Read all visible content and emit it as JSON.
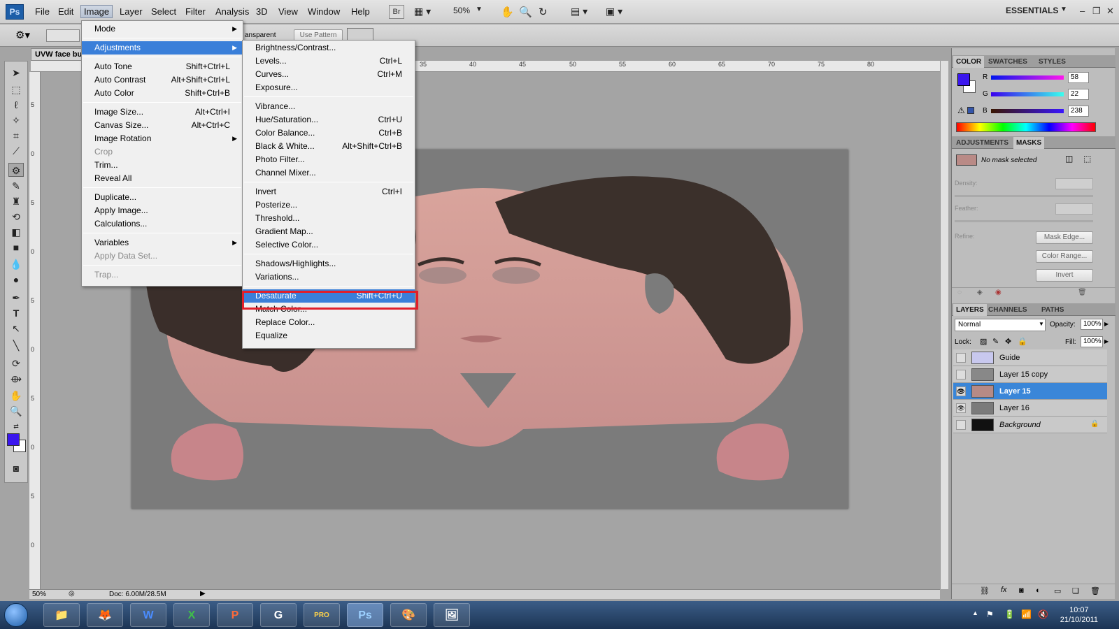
{
  "app": {
    "logo": "Ps",
    "workspace": "ESSENTIALS",
    "zoom": "50%"
  },
  "menubar": [
    "File",
    "Edit",
    "Image",
    "Layer",
    "Select",
    "Filter",
    "Analysis",
    "3D",
    "View",
    "Window",
    "Help"
  ],
  "toolbar": {
    "bridge": "Br"
  },
  "options": {
    "transparent_label": "ansparent",
    "use_pattern": "Use Pattern"
  },
  "document": {
    "tab_title": "UVW face bu",
    "zoom_status": "50%",
    "doc_info": "Doc: 6.00M/28.5M"
  },
  "ruler_top": [
    "35",
    "40",
    "45",
    "50",
    "55",
    "60",
    "65",
    "70",
    "75",
    "80"
  ],
  "ruler_left": [
    "5",
    "0",
    "5",
    "0",
    "5",
    "0",
    "5",
    "0",
    "5",
    "0",
    "5"
  ],
  "image_menu": {
    "items": [
      {
        "label": "Mode",
        "shortcut": "",
        "submenu": true,
        "disabled": false
      },
      {
        "label": "Adjustments",
        "shortcut": "",
        "submenu": true,
        "disabled": false,
        "highlight": true
      },
      {
        "label": "Auto Tone",
        "shortcut": "Shift+Ctrl+L",
        "disabled": false
      },
      {
        "label": "Auto Contrast",
        "shortcut": "Alt+Shift+Ctrl+L",
        "disabled": false
      },
      {
        "label": "Auto Color",
        "shortcut": "Shift+Ctrl+B",
        "disabled": false
      },
      {
        "label": "Image Size...",
        "shortcut": "Alt+Ctrl+I",
        "disabled": false
      },
      {
        "label": "Canvas Size...",
        "shortcut": "Alt+Ctrl+C",
        "disabled": false
      },
      {
        "label": "Image Rotation",
        "shortcut": "",
        "submenu": true,
        "disabled": false
      },
      {
        "label": "Crop",
        "shortcut": "",
        "disabled": true
      },
      {
        "label": "Trim...",
        "shortcut": "",
        "disabled": false
      },
      {
        "label": "Reveal All",
        "shortcut": "",
        "disabled": false
      },
      {
        "label": "Duplicate...",
        "shortcut": "",
        "disabled": false
      },
      {
        "label": "Apply Image...",
        "shortcut": "",
        "disabled": false
      },
      {
        "label": "Calculations...",
        "shortcut": "",
        "disabled": false
      },
      {
        "label": "Variables",
        "shortcut": "",
        "submenu": true,
        "disabled": false
      },
      {
        "label": "Apply Data Set...",
        "shortcut": "",
        "disabled": true
      },
      {
        "label": "Trap...",
        "shortcut": "",
        "disabled": true
      }
    ]
  },
  "adjust_menu": {
    "items": [
      {
        "label": "Brightness/Contrast...",
        "shortcut": ""
      },
      {
        "label": "Levels...",
        "shortcut": "Ctrl+L"
      },
      {
        "label": "Curves...",
        "shortcut": "Ctrl+M"
      },
      {
        "label": "Exposure...",
        "shortcut": ""
      },
      {
        "label": "Vibrance...",
        "shortcut": ""
      },
      {
        "label": "Hue/Saturation...",
        "shortcut": "Ctrl+U"
      },
      {
        "label": "Color Balance...",
        "shortcut": "Ctrl+B"
      },
      {
        "label": "Black & White...",
        "shortcut": "Alt+Shift+Ctrl+B"
      },
      {
        "label": "Photo Filter...",
        "shortcut": ""
      },
      {
        "label": "Channel Mixer...",
        "shortcut": ""
      },
      {
        "label": "Invert",
        "shortcut": "Ctrl+I"
      },
      {
        "label": "Posterize...",
        "shortcut": ""
      },
      {
        "label": "Threshold...",
        "shortcut": ""
      },
      {
        "label": "Gradient Map...",
        "shortcut": ""
      },
      {
        "label": "Selective Color...",
        "shortcut": ""
      },
      {
        "label": "Shadows/Highlights...",
        "shortcut": ""
      },
      {
        "label": "Variations...",
        "shortcut": ""
      },
      {
        "label": "Desaturate",
        "shortcut": "Shift+Ctrl+U",
        "highlight": true
      },
      {
        "label": "Match Color...",
        "shortcut": ""
      },
      {
        "label": "Replace Color...",
        "shortcut": ""
      },
      {
        "label": "Equalize",
        "shortcut": ""
      }
    ]
  },
  "color_panel": {
    "tabs": [
      "COLOR",
      "SWATCHES",
      "STYLES"
    ],
    "r": "58",
    "g": "22",
    "b": "238",
    "r_label": "R",
    "g_label": "G",
    "b_label": "B",
    "fg_color": "#3a16ee"
  },
  "masks_panel": {
    "tabs": [
      "ADJUSTMENTS",
      "MASKS"
    ],
    "status": "No mask selected",
    "density": "Density:",
    "feather": "Feather:",
    "refine": "Refine:",
    "buttons": [
      "Mask Edge...",
      "Color Range...",
      "Invert"
    ]
  },
  "layers_panel": {
    "tabs": [
      "LAYERS",
      "CHANNELS",
      "PATHS"
    ],
    "blend_mode": "Normal",
    "opacity_label": "Opacity:",
    "opacity": "100%",
    "lock_label": "Lock:",
    "fill_label": "Fill:",
    "fill": "100%",
    "layers": [
      {
        "name": "Guide",
        "visible": false,
        "selected": false
      },
      {
        "name": "Layer 15 copy",
        "visible": false,
        "selected": false
      },
      {
        "name": "Layer 15",
        "visible": true,
        "selected": true
      },
      {
        "name": "Layer 16",
        "visible": true,
        "selected": false
      },
      {
        "name": "Background",
        "visible": false,
        "selected": false,
        "locked": true
      }
    ]
  },
  "taskbar": {
    "time": "10:07",
    "date": "21/10/2011",
    "apps": [
      "W",
      "X",
      "P",
      "G",
      "PRO",
      "Ps"
    ]
  },
  "colors": {
    "highlight": "#3a7fd9",
    "redbox": "#e11f2a",
    "layer_selected": "#3a86d8"
  }
}
